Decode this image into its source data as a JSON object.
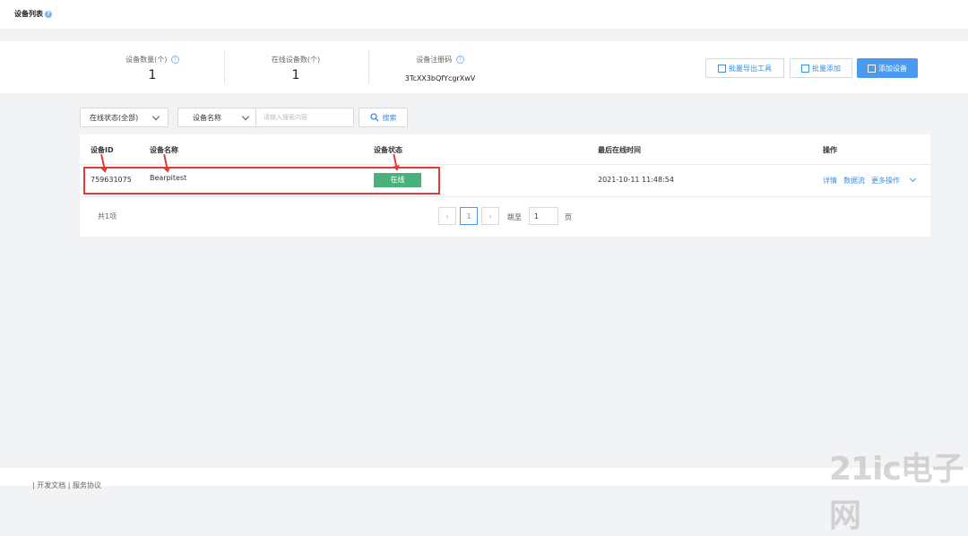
{
  "header": {
    "title": "设备列表",
    "help": "?"
  },
  "stats": {
    "device_count_label": "设备数量(个)",
    "device_count": "1",
    "online_count_label": "在线设备数(个)",
    "online_count": "1",
    "reg_code_label": "设备注册码",
    "reg_code": "3TcXX3bQfYcgrXwV"
  },
  "actions": {
    "export_tool": "批量导出工具",
    "batch_add": "批量添加",
    "add_device": "添加设备"
  },
  "filters": {
    "status_select": "在线状态(全部)",
    "field_select": "设备名称",
    "search_placeholder": "请输入搜索内容",
    "search_button": "搜索"
  },
  "table": {
    "columns": [
      "设备ID",
      "设备名称",
      "设备状态",
      "最后在线时间",
      "操作"
    ],
    "rows": [
      {
        "id": "759631075",
        "name": "Bearpitest",
        "status": "在线",
        "last_online": "2021-10-11 11:48:54",
        "ops": [
          "详情",
          "数据流",
          "更多操作"
        ]
      }
    ]
  },
  "pagination": {
    "total": "共1项",
    "current": "1",
    "jump_label": "跳至",
    "jump_value": "1",
    "page_unit": "页"
  },
  "footer": {
    "text": "| 开发文档 | 服务协议"
  },
  "watermark": "21ic电子网",
  "colors": {
    "accent": "#4a9bf0",
    "online": "#49b27b",
    "highlight": "#e03b3b"
  }
}
